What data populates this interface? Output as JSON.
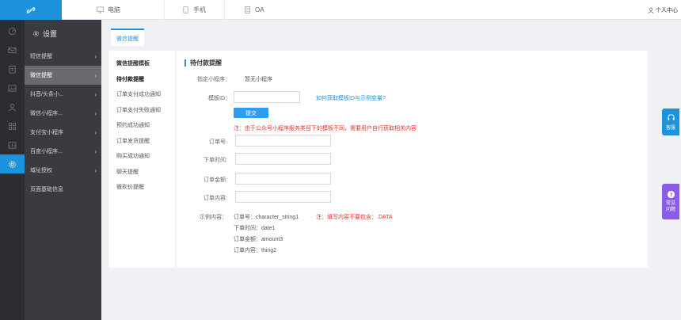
{
  "topbar": {
    "tabs": [
      {
        "label": "电脑",
        "icon": "monitor-icon"
      },
      {
        "label": "手机",
        "icon": "phone-icon"
      },
      {
        "label": "OA",
        "icon": "document-icon"
      }
    ],
    "user_center": "个人中心"
  },
  "sidebar": {
    "title": "设置",
    "items": [
      {
        "label": "短信提醒"
      },
      {
        "label": "微信提醒"
      },
      {
        "label": "抖音/头条小..."
      },
      {
        "label": "微信小程序..."
      },
      {
        "label": "支付宝小程序"
      },
      {
        "label": "百度小程序..."
      },
      {
        "label": "域址授权"
      },
      {
        "label": "页面基础信息"
      }
    ]
  },
  "content": {
    "tab": "微信提醒",
    "template_list": {
      "head": "微信提醒模板",
      "items": [
        "待付款提醒",
        "订单支付成功通知",
        "订单支付失败通知",
        "预约成功通知",
        "订单发货提醒",
        "购买成功通知",
        "聊天提醒",
        "微砍价提醒"
      ]
    },
    "form": {
      "title": "待付款提醒",
      "mini_program_label": "指定小程序：",
      "mini_program_value": "暂无小程序",
      "template_id_label": "模板ID：",
      "template_id_value": "",
      "template_id_link": "如何获取模板ID与示例变量?",
      "submit": "提交",
      "note_top": "注：由于公众号小程序服务类目下的模板不同，需要用户自行获取相关内容",
      "order_no_label": "订单号:",
      "order_time_label": "下单时间:",
      "order_amount_label": "订单金额:",
      "order_content_label": "订单内容:",
      "example_label": "示例内容：",
      "example_lines": [
        "订单号：character_string1",
        "下单时间：date1",
        "订单金额：amount3",
        "订单内容：thing2"
      ],
      "note_example": "注：填写内容不要包含：.DATA"
    }
  },
  "floating": {
    "service": "客服",
    "faq": "常见问题"
  },
  "colors": {
    "accent": "#1e93dd",
    "sidebar_bg": "#393b40",
    "rail_bg": "#2b2d31",
    "note": "#e0352b",
    "faq": "#8b5ce5"
  }
}
